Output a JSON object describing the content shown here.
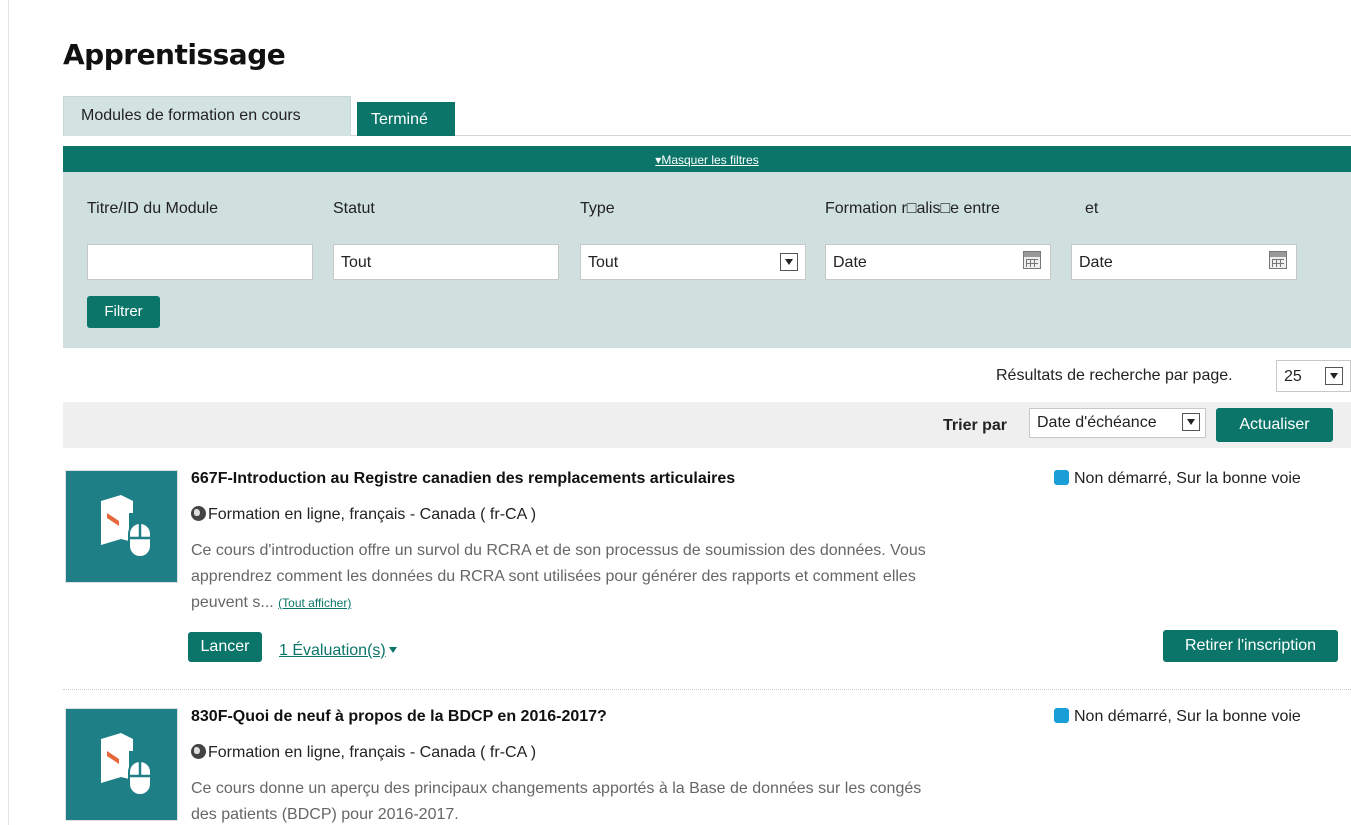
{
  "page": {
    "title": "Apprentissage"
  },
  "tabs": [
    {
      "label": "Modules de formation en cours",
      "active": true
    },
    {
      "label": "Terminé",
      "active": false
    }
  ],
  "filters": {
    "toggle_label": "Masquer les filtres",
    "labels": {
      "title": "Titre/ID du Module",
      "status": "Statut",
      "type": "Type",
      "date_from": "Formation r□alis□e entre",
      "date_to": "et"
    },
    "title_value": "",
    "status_value": "Tout",
    "type_value": "Tout",
    "date_from_placeholder": "Date",
    "date_to_placeholder": "Date",
    "button": "Filtrer"
  },
  "pagination": {
    "label": "Résultats de recherche par page.",
    "value": "25"
  },
  "sort": {
    "label": "Trier par",
    "value": "Date d'échéance",
    "refresh": "Actualiser"
  },
  "courses": [
    {
      "title": "667F-Introduction au Registre canadien des remplacements articulaires",
      "meta": "Formation en ligne, français - Canada ( fr-CA )",
      "description": "Ce cours d'introduction offre un survol du RCRA et de son processus de soumission des données. Vous apprendrez comment les données du RCRA sont utilisées pour générer des rapports et comment elles peuvent s...",
      "show_all": "(Tout afficher)",
      "status": "Non démarré, Sur la bonne voie",
      "launch": "Lancer",
      "evaluations": "1 Évaluation(s)",
      "withdraw": "Retirer l'inscription"
    },
    {
      "title": "830F-Quoi de neuf à propos de la BDCP en 2016-2017?",
      "meta": "Formation en ligne, français - Canada ( fr-CA )",
      "description": "Ce cours donne un aperçu des principaux changements apportés à la Base de données sur les congés des patients (BDCP) pour 2016-2017.",
      "status": "Non démarré, Sur la bonne voie"
    }
  ],
  "colors": {
    "primary": "#0b7569",
    "filter_panel": "#cfe0de",
    "thumbnail": "#1f7f86",
    "status_dot": "#1a9ed8"
  }
}
